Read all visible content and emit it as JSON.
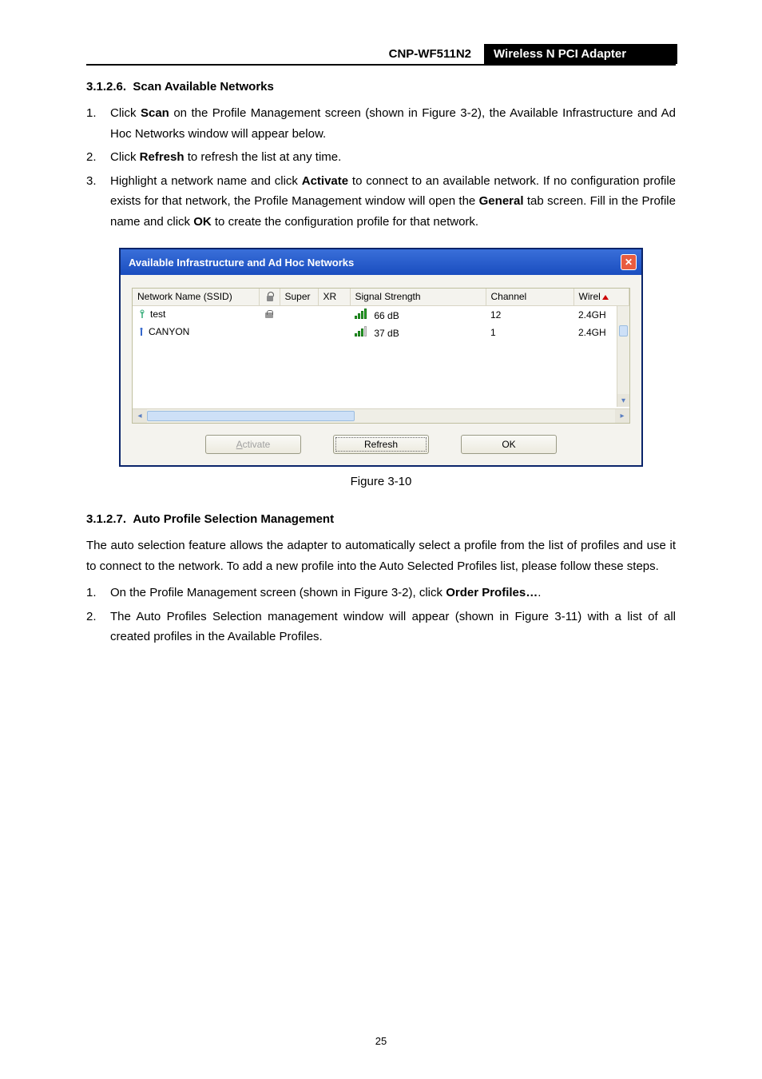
{
  "header": {
    "model": "CNP-WF511N2",
    "title": "Wireless N PCI Adapter"
  },
  "section_3126": {
    "number": "3.1.2.6.",
    "title": "Scan Available Networks",
    "steps": [
      {
        "pre": "Click ",
        "b": "Scan",
        "post": " on the Profile Management screen (shown in Figure 3-2), the Available Infrastructure and Ad Hoc Networks window will appear below."
      },
      {
        "pre": "Click ",
        "b": "Refresh",
        "post": " to refresh the list at any time."
      },
      {
        "pre": "Highlight a network name and click ",
        "b": "Activate",
        "post": " to connect to an available network. If no configuration profile exists for that network, the Profile Management window will open the ",
        "b2": "General",
        "post2": " tab screen. Fill in the Profile name and click ",
        "b3": "OK",
        "post3": " to create the configuration profile for that network."
      }
    ]
  },
  "dialog": {
    "title": "Available Infrastructure and Ad Hoc Networks",
    "columns": {
      "ssid": "Network Name (SSID)",
      "super": "Super",
      "xr": "XR",
      "signal": "Signal Strength",
      "channel": "Channel",
      "wireless": "Wirel"
    },
    "rows": [
      {
        "ssid": "test",
        "locked": true,
        "type": "infra",
        "signal": "66 dB",
        "channel": "12",
        "wireless": "2.4GH"
      },
      {
        "ssid": "CANYON",
        "locked": false,
        "type": "adhoc",
        "signal": "37 dB",
        "channel": "1",
        "wireless": "2.4GH"
      }
    ],
    "buttons": {
      "activate": "Activate",
      "refresh": "Refresh",
      "ok": "OK"
    }
  },
  "figure_caption": "Figure 3-10",
  "section_3127": {
    "number": "3.1.2.7.",
    "title": "Auto Profile Selection Management",
    "intro": "The auto selection feature allows the adapter to automatically select a profile from the list of profiles and use it to connect to the network. To add a new profile into the Auto Selected Profiles list, please follow these steps.",
    "steps": [
      {
        "pre": "On the Profile Management screen (shown in Figure 3-2), click ",
        "b": "Order Profiles…",
        "post": "."
      },
      {
        "pre": "The Auto Profiles Selection management window will appear (shown in Figure 3-11) with a list of all created profiles in the Available Profiles.",
        "b": "",
        "post": ""
      }
    ]
  },
  "page_number": "25"
}
